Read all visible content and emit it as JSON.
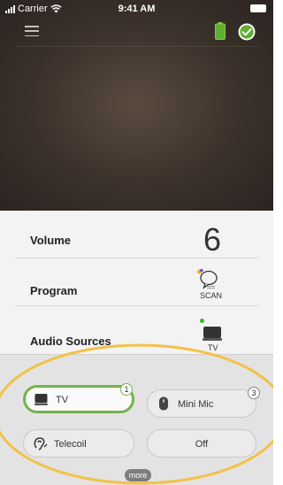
{
  "status_bar": {
    "carrier": "Carrier",
    "time": "9:41 AM"
  },
  "colors": {
    "accent_green": "#74b34a",
    "highlight_ring": "#f2c248"
  },
  "header": {
    "menu_icon": "hamburger-menu-icon",
    "battery_icon": "battery-icon",
    "status_icon": "check-circle-icon"
  },
  "rows": {
    "volume": {
      "label": "Volume",
      "value": "6"
    },
    "program": {
      "label": "Program",
      "value": "SCAN",
      "icon": "speech-bubble-icon"
    },
    "audio_sources": {
      "label": "Audio Sources",
      "value": "TV",
      "icon": "tv-icon"
    }
  },
  "sources": {
    "tv": {
      "label": "TV",
      "badge": "1",
      "selected": true
    },
    "mini_mic": {
      "label": "Mini Mic",
      "badge": "3"
    },
    "telecoil": {
      "label": "Telecoil"
    },
    "off": {
      "label": "Off"
    },
    "more_label": "more"
  }
}
